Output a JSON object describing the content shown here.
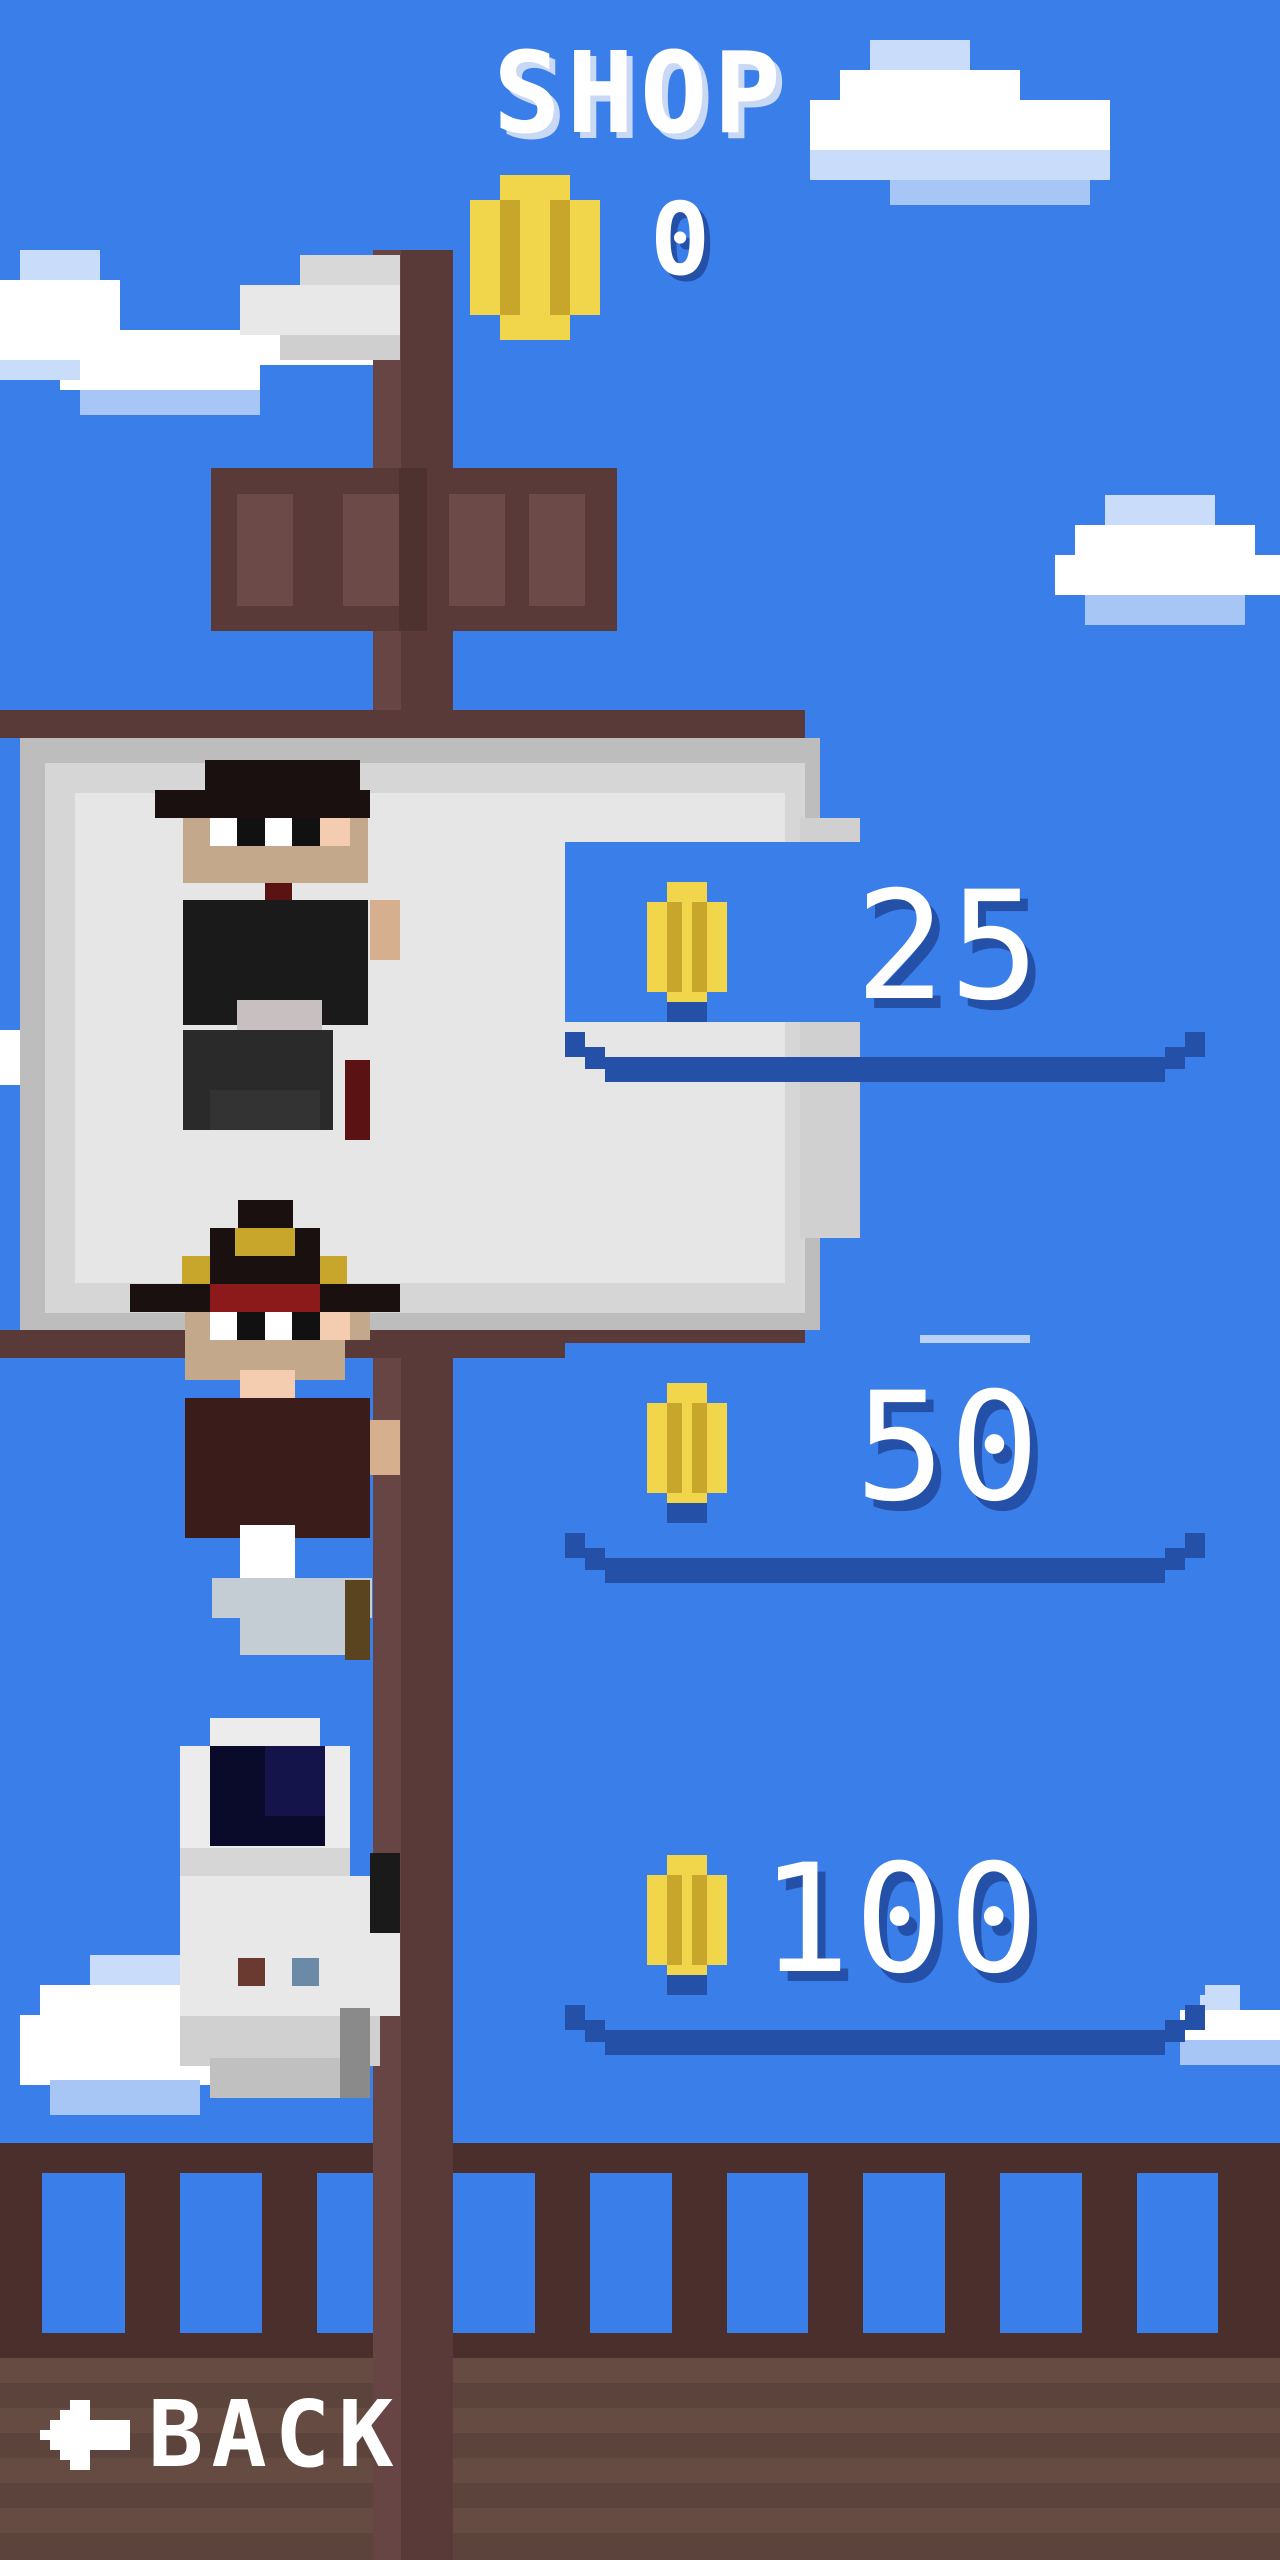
{
  "screen": {
    "title": "SHOP",
    "coins": "0"
  },
  "items": [
    {
      "character": "masked-pirate",
      "price": "25"
    },
    {
      "character": "captain-pirate",
      "price": "50"
    },
    {
      "character": "astronaut",
      "price": "100"
    }
  ],
  "back_label": "BACK",
  "colors": {
    "sky": "#3a7fe9",
    "shadow_blue": "#2450a8",
    "coin_gold": "#f1d54a",
    "coin_dark": "#c8a62c",
    "mast": "#5a3a38",
    "deck": "#654b42",
    "sail": "#e6e6e6"
  },
  "icons": [
    "coin-icon",
    "arrow-left-icon"
  ]
}
